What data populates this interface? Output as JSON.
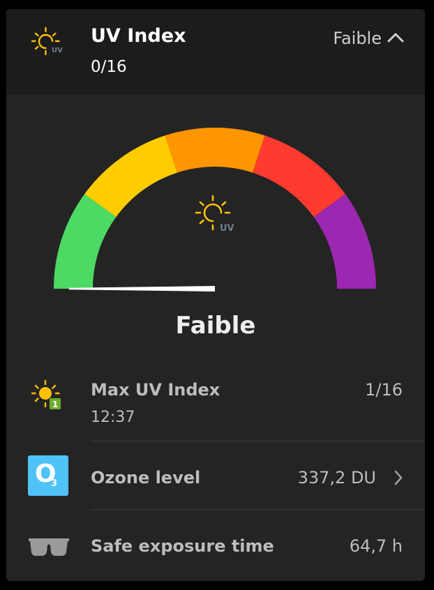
{
  "header": {
    "title": "UV Index",
    "value": "0/16",
    "status": "Faible",
    "icon": "uv-sun-icon",
    "collapse_icon": "chevron-up-icon"
  },
  "gauge": {
    "level": 0,
    "max": 16,
    "center_icon": "uv-sun-icon",
    "icon_text": "UV",
    "segment_colors": [
      "#4cd964",
      "#ffcc00",
      "#ff9500",
      "#ff3b30",
      "#9c27b0"
    ],
    "label": "Faible"
  },
  "rows": {
    "max_uv": {
      "label": "Max UV Index",
      "time": "12:37",
      "value": "1/16",
      "icon": "sun-badge-icon",
      "badge": "1"
    },
    "ozone": {
      "label": "Ozone level",
      "value": "337,2 DU",
      "icon": "ozone-icon",
      "badge_main": "O",
      "badge_sub": "3",
      "chevron": "chevron-right-icon"
    },
    "exposure": {
      "label": "Safe exposure time",
      "value": "64,7 h",
      "icon": "sunglasses-icon"
    }
  },
  "colors": {
    "background": "#242424",
    "header_bg": "#1c1c1c",
    "sun": "#ffc107",
    "ozone_badge": "#4fc3f7",
    "uv_badge": "#6cae2e"
  }
}
